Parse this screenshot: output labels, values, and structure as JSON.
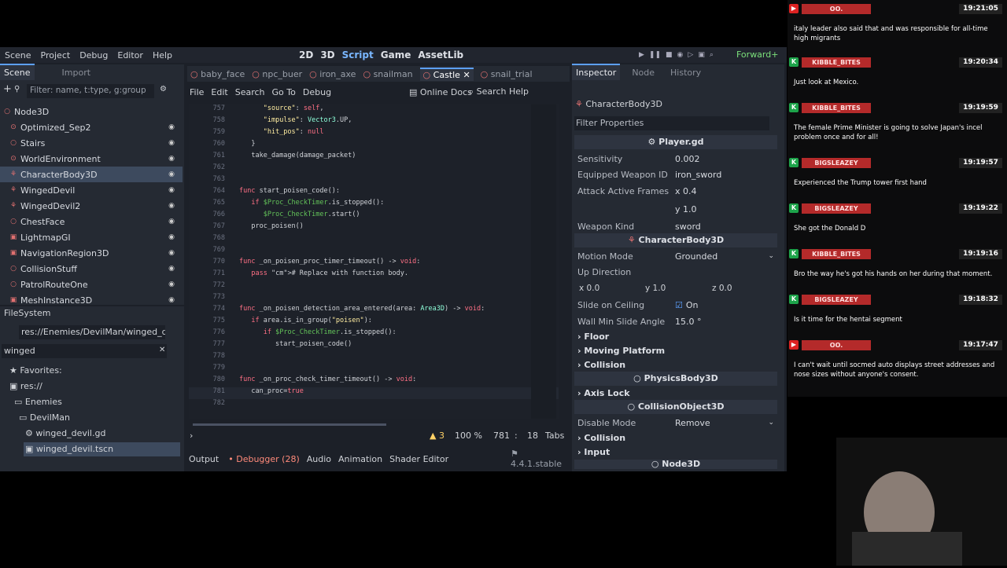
{
  "menu": {
    "items": [
      "Scene",
      "Project",
      "Debug",
      "Editor",
      "Help"
    ],
    "views": [
      "2D",
      "3D",
      "Script",
      "Game",
      "AssetLib"
    ],
    "renderer": "Forward+"
  },
  "scene_dock": {
    "tabs": [
      "Scene",
      "Import"
    ],
    "filter_placeholder": "Filter: name, t:type, g:group",
    "nodes": [
      {
        "label": "Node3D"
      },
      {
        "label": "Optimized_Sep2"
      },
      {
        "label": "Stairs"
      },
      {
        "label": "WorldEnvironment"
      },
      {
        "label": "CharacterBody3D"
      },
      {
        "label": "WingedDevil"
      },
      {
        "label": "WingedDevil2"
      },
      {
        "label": "ChestFace"
      },
      {
        "label": "LightmapGI"
      },
      {
        "label": "NavigationRegion3D"
      },
      {
        "label": "CollisionStuff"
      },
      {
        "label": "PatrolRouteOne"
      },
      {
        "label": "MeshInstance3D"
      }
    ]
  },
  "filesystem": {
    "title": "FileSystem",
    "path": "res://Enemies/DevilMan/winged_devil",
    "search": "winged",
    "items": [
      "Favorites:",
      "res://",
      "Enemies",
      "DevilMan",
      "winged_devil.gd",
      "winged_devil.tscn"
    ]
  },
  "script_tabs": [
    "baby_face",
    "npc_buer",
    "iron_axe",
    "snailman",
    "Castle",
    "snail_trial"
  ],
  "script_menu": [
    "File",
    "Edit",
    "Search",
    "Go To",
    "Debug"
  ],
  "online_docs": "Online Docs",
  "search_help": "Search Help",
  "code_lines": [
    {
      "n": "757",
      "t": "      \"source\": self,"
    },
    {
      "n": "758",
      "t": "      \"impulse\": Vector3.UP,"
    },
    {
      "n": "759",
      "t": "      \"hit_pos\": null"
    },
    {
      "n": "760",
      "t": "   }"
    },
    {
      "n": "761",
      "t": "   take_damage(damage_packet)"
    },
    {
      "n": "762",
      "t": ""
    },
    {
      "n": "763",
      "t": ""
    },
    {
      "n": "764",
      "t": "func start_poisen_code():"
    },
    {
      "n": "765",
      "t": "   if $Proc_CheckTimer.is_stopped():"
    },
    {
      "n": "766",
      "t": "      $Proc_CheckTimer.start()"
    },
    {
      "n": "767",
      "t": "   proc_poisen()"
    },
    {
      "n": "768",
      "t": ""
    },
    {
      "n": "769",
      "t": ""
    },
    {
      "n": "770",
      "t": "func _on_poisen_proc_timer_timeout() -> void:"
    },
    {
      "n": "771",
      "t": "   pass # Replace with function body."
    },
    {
      "n": "772",
      "t": ""
    },
    {
      "n": "773",
      "t": ""
    },
    {
      "n": "774",
      "t": "func _on_poisen_detection_area_entered(area: Area3D) -> void:"
    },
    {
      "n": "775",
      "t": "   if area.is_in_group(\"poisen\"):"
    },
    {
      "n": "776",
      "t": "      if $Proc_CheckTimer.is_stopped():"
    },
    {
      "n": "777",
      "t": "         start_poisen_code()"
    },
    {
      "n": "778",
      "t": ""
    },
    {
      "n": "779",
      "t": ""
    },
    {
      "n": "780",
      "t": "func _on_proc_check_timer_timeout() -> void:"
    },
    {
      "n": "781",
      "t": "   can_proc=true"
    },
    {
      "n": "782",
      "t": ""
    }
  ],
  "status": {
    "warnings": "3",
    "zoom": "100 %",
    "line": "781",
    "col": "18",
    "tabs": "Tabs"
  },
  "bottom_tabs": [
    "Output",
    "Debugger (28)",
    "Audio",
    "Animation",
    "Shader Editor"
  ],
  "version": "4.4.1.stable",
  "inspector": {
    "tabs": [
      "Inspector",
      "Node",
      "History"
    ],
    "object": "CharacterBody3D",
    "filter": "Filter Properties",
    "script": "Player.gd",
    "props": [
      {
        "k": "Sensitivity",
        "v": "0.002"
      },
      {
        "k": "Equipped Weapon ID",
        "v": "iron_sword"
      },
      {
        "k": "Attack Active Frames",
        "v": "x  0.4"
      },
      {
        "k": "",
        "v": "y  1.0"
      },
      {
        "k": "Weapon Kind",
        "v": "sword"
      }
    ],
    "section2": "CharacterBody3D",
    "motion_mode_k": "Motion Mode",
    "motion_mode_v": "Grounded",
    "up_direction": "Up Direction",
    "up_vec": [
      "x  0.0",
      "y  1.0",
      "z  0.0"
    ],
    "slide_k": "Slide on Ceiling",
    "slide_v": "On",
    "wall_k": "Wall Min Slide Angle",
    "wall_v": "15.0 °",
    "groups": [
      "Floor",
      "Moving Platform",
      "Collision"
    ],
    "section3": "PhysicsBody3D",
    "axis_lock": "Axis Lock",
    "section4": "CollisionObject3D",
    "disable_k": "Disable Mode",
    "disable_v": "Remove",
    "groups2": [
      "Collision",
      "Input"
    ],
    "section5": "Node3D"
  },
  "chat": [
    {
      "user": "OO.",
      "time": "19:21:05",
      "badge": "red",
      "text": "italy leader also said that and was responsible for all-time high migrants"
    },
    {
      "user": "KIBBLE_BITES",
      "time": "19:20:34",
      "badge": "green",
      "text": "Just look at Mexico."
    },
    {
      "user": "KIBBLE_BITES",
      "time": "19:19:59",
      "badge": "green",
      "text": "The female Prime Minister is going to solve Japan's incel problem once and for all!"
    },
    {
      "user": "BIGSLEAZEY",
      "time": "19:19:57",
      "badge": "green",
      "text": "Experienced the Trump tower first hand"
    },
    {
      "user": "BIGSLEAZEY",
      "time": "19:19:22",
      "badge": "green",
      "text": "She got the Donald D"
    },
    {
      "user": "KIBBLE_BITES",
      "time": "19:19:16",
      "badge": "green",
      "text": "Bro the way he's got his hands on her during that moment."
    },
    {
      "user": "BIGSLEAZEY",
      "time": "19:18:32",
      "badge": "green",
      "text": "Is it time for the hentai segment"
    },
    {
      "user": "OO.",
      "time": "19:17:47",
      "badge": "red",
      "text": "I can't wait until socmed auto displays street addresses and nose sizes without anyone's consent."
    }
  ],
  "colors": {
    "accent": "#5da0ff",
    "chat_name_bg": "#b42a2a"
  }
}
